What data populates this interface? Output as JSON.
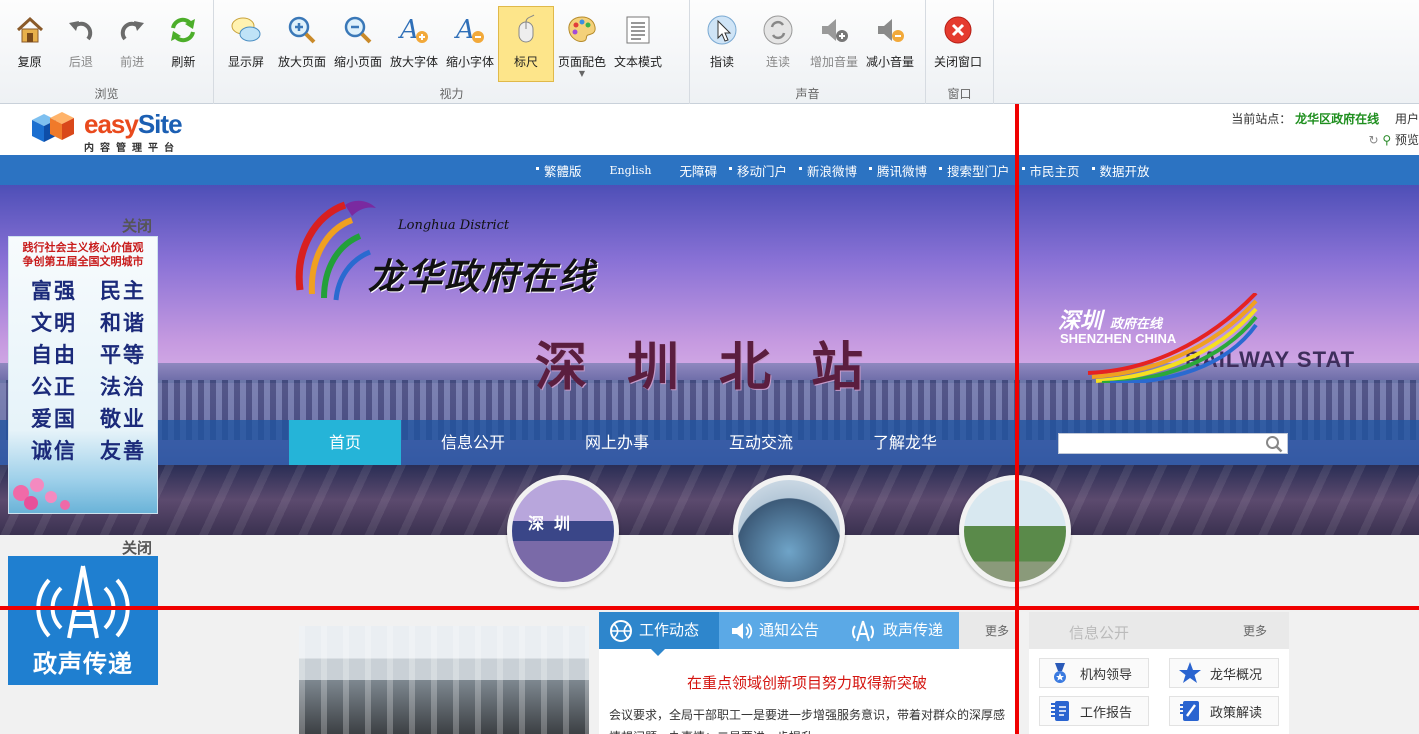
{
  "toolbar": {
    "groups": [
      {
        "label": "浏览",
        "buttons": [
          {
            "label": "复原",
            "icon": "home-icon"
          },
          {
            "label": "后退",
            "icon": "back-icon",
            "disabled": true
          },
          {
            "label": "前进",
            "icon": "forward-icon",
            "disabled": true
          },
          {
            "label": "刷新",
            "icon": "refresh-icon"
          }
        ]
      },
      {
        "label": "视力",
        "buttons": [
          {
            "label": "显示屏",
            "icon": "display-icon"
          },
          {
            "label": "放大页面",
            "icon": "zoom-in-icon"
          },
          {
            "label": "缩小页面",
            "icon": "zoom-out-icon"
          },
          {
            "label": "放大字体",
            "icon": "font-enlarge-icon"
          },
          {
            "label": "缩小字体",
            "icon": "font-shrink-icon"
          },
          {
            "label": "标尺",
            "icon": "ruler-mouse-icon",
            "active": true
          },
          {
            "label": "页面配色",
            "icon": "palette-icon",
            "caret": "▼"
          },
          {
            "label": "文本模式",
            "icon": "text-mode-icon"
          }
        ]
      },
      {
        "label": "声音",
        "buttons": [
          {
            "label": "指读",
            "icon": "pointer-read-icon"
          },
          {
            "label": "连读",
            "icon": "continuous-read-icon",
            "disabled": true
          },
          {
            "label": "增加音量",
            "icon": "volume-up-icon",
            "disabled": true
          },
          {
            "label": "减小音量",
            "icon": "volume-down-icon"
          }
        ]
      },
      {
        "label": "窗口",
        "buttons": [
          {
            "label": "关闭窗口",
            "icon": "close-window-icon"
          }
        ]
      }
    ]
  },
  "header": {
    "logo_e": "easy",
    "logo_s": "Site",
    "logo_sub": "内容管理平台",
    "current_label": "当前站点：",
    "current_site": "龙华区政府在线",
    "user_label": "用户",
    "preview_label": "预览"
  },
  "linkbar": [
    "繁體版",
    "English",
    "无障碍",
    "移动门户",
    "新浪微博",
    "腾讯微博",
    "搜索型门户",
    "市民主页",
    "数据开放"
  ],
  "banner": {
    "logo_cn": "龙华政府在线",
    "logo_en": "Longhua District",
    "station": "深圳北站",
    "rail_text": "RAILWAY STAT",
    "sz_cn": "深圳",
    "sz_cn_small": "政府在线",
    "sz_en": "SHENZHEN CHINA",
    "circle1_text": "深圳"
  },
  "mainnav": {
    "items": [
      "首页",
      "信息公开",
      "网上办事",
      "互动交流",
      "了解龙华"
    ],
    "search_placeholder": ""
  },
  "side_ads": {
    "close1": "关闭",
    "close2": "关闭",
    "slogan_line1": "践行社会主义核心价值观",
    "slogan_line2": "争创第五届全国文明城市",
    "values": [
      "富强　民主",
      "文明　和谐",
      "自由　平等",
      "公正　法治",
      "爱国　敬业",
      "诚信　友善"
    ],
    "ad2_text": "政声传递"
  },
  "news": {
    "tabs": [
      {
        "label": "工作动态",
        "icon": "ball-icon"
      },
      {
        "label": "通知公告",
        "icon": "speaker-icon"
      },
      {
        "label": "政声传递",
        "icon": "tower-icon"
      }
    ],
    "more": "更多",
    "headline": "在重点领域创新项目努力取得新突破",
    "summary": "会议要求，全局干部职工一是要进一步增强服务意识，带着对群众的深厚感情想问题、办事情；二是要进一步提升"
  },
  "info": {
    "title": "信息公开",
    "more": "更多",
    "items": [
      {
        "label": "机构领导",
        "icon": "leader-icon"
      },
      {
        "label": "龙华概况",
        "icon": "star-icon"
      },
      {
        "label": "工作报告",
        "icon": "report-icon"
      },
      {
        "label": "政策解读",
        "icon": "policy-icon"
      }
    ]
  },
  "colors": {
    "linkbar": "#2c73c2",
    "nav_active": "#25b4d8",
    "tab_active": "#2e86cc",
    "ruler": "#f00000",
    "headline": "#d4140f"
  }
}
